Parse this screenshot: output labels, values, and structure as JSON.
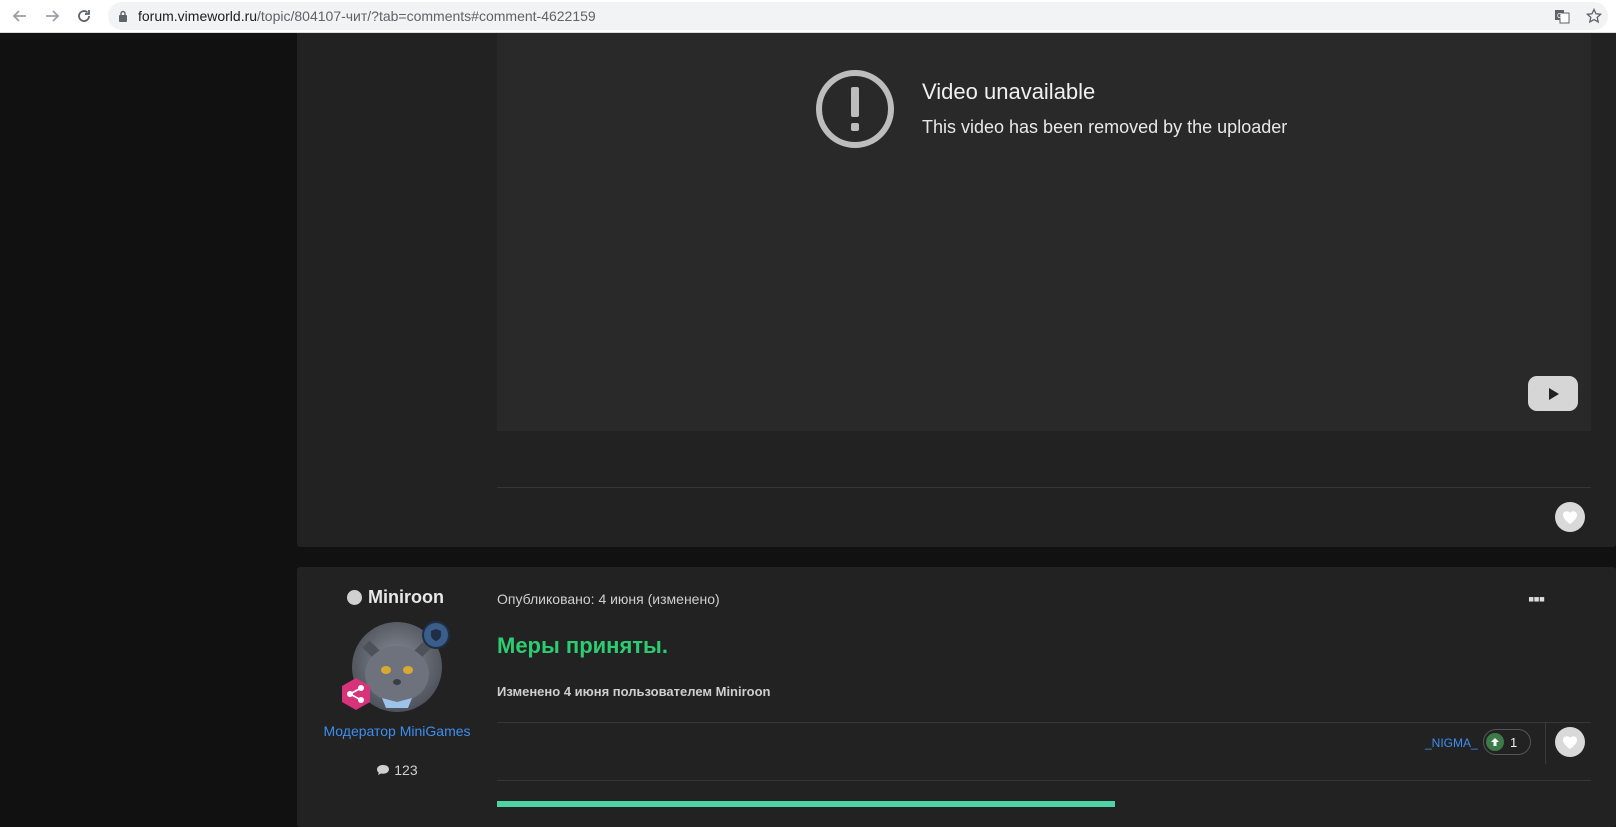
{
  "browser": {
    "url_host": "forum.vimeworld.ru",
    "url_path": "/topic/804107-чит/?tab=comments#comment-4622159"
  },
  "post1": {
    "video_title": "Video unavailable",
    "video_subtitle": "This video has been removed by the uploader"
  },
  "post2": {
    "author": "Miniroon",
    "rank": "Модератор MiniGames",
    "post_count": "123",
    "date": "Опубликовано: 4 июня (изменено)",
    "text": "Меры приняты.",
    "edited": "Изменено 4 июня пользователем Miniroon",
    "reactor": "_NIGMA_",
    "reaction_count": "1"
  },
  "colors": {
    "page_bg": "#111111",
    "post_bg": "#222222",
    "accent_green": "#2ecc71",
    "link_blue": "#3d8ef0",
    "bar_teal": "#4fd3a4"
  }
}
